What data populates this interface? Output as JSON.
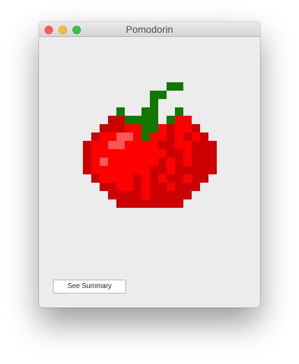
{
  "window": {
    "title": "Pomodorin"
  },
  "main": {
    "image_icon": "pixel-tomato-icon",
    "summary_button_label": "See Summary"
  },
  "colors": {
    "tomato_red": "#ff0000",
    "tomato_dark": "#cc0000",
    "tomato_highlight": "#ff5555",
    "stem_green": "#117700"
  }
}
